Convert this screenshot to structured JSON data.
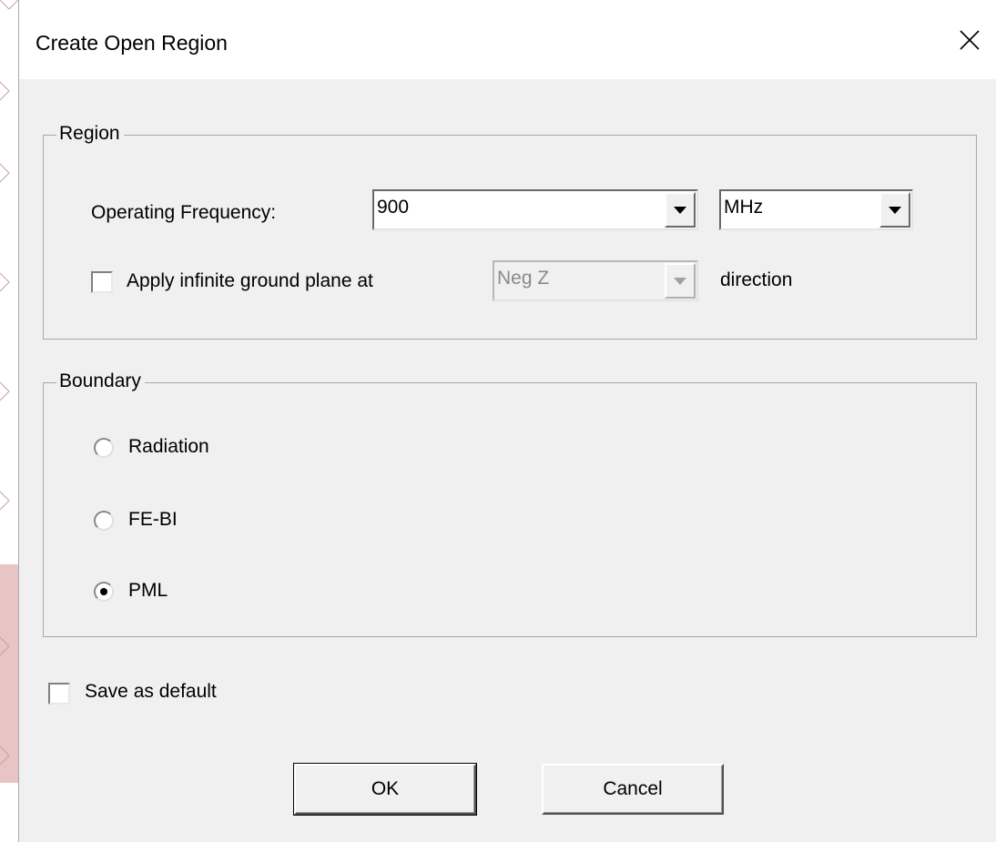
{
  "dialog": {
    "title": "Create Open Region",
    "close_icon": "close-icon"
  },
  "region": {
    "legend": "Region",
    "frequency_label": "Operating Frequency:",
    "frequency_value": "900",
    "frequency_unit": "MHz",
    "ground_plane_label": "Apply infinite ground plane at",
    "ground_plane_checked": false,
    "ground_plane_direction": "Neg Z",
    "direction_suffix": "direction"
  },
  "boundary": {
    "legend": "Boundary",
    "options": [
      {
        "label": "Radiation",
        "selected": false
      },
      {
        "label": "FE-BI",
        "selected": false
      },
      {
        "label": "PML",
        "selected": true
      }
    ]
  },
  "save_default": {
    "label": "Save as default",
    "checked": false
  },
  "buttons": {
    "ok": "OK",
    "cancel": "Cancel"
  },
  "colors": {
    "dialog_bg": "#f0f0f0",
    "titlebar_bg": "#ffffff",
    "background_grid": "#d8a0a0"
  }
}
